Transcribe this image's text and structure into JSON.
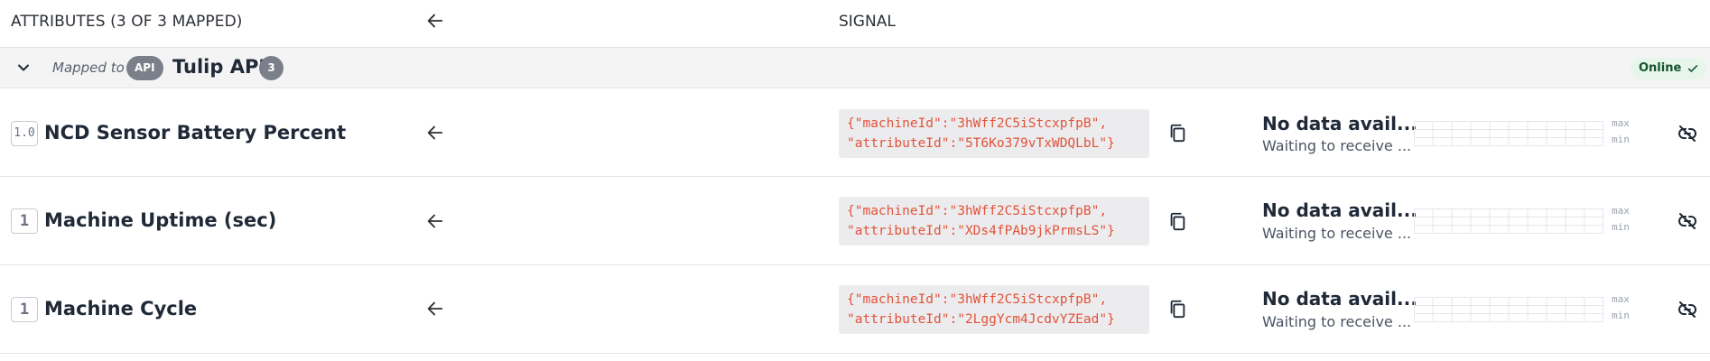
{
  "header": {
    "attributes_title": "ATTRIBUTES (3 OF 3 MAPPED)",
    "signal_title": "SIGNAL"
  },
  "group": {
    "mapped_to_label": "Mapped to",
    "api_badge": "API",
    "api_name": "Tulip API",
    "count": "3",
    "status_label": "Online"
  },
  "rows": [
    {
      "type_badge": "1.0",
      "name": "NCD Sensor Battery Percent",
      "signal_line1": "{\"machineId\":\"3hWff2C5iStcxpfpB\",",
      "signal_line2": "\"attributeId\":\"5T6Ko379vTxWDQLbL\"}",
      "status_title": "No data avail...",
      "status_sub": "Waiting to receive ...",
      "max_label": "max",
      "min_label": "min"
    },
    {
      "type_badge": "1",
      "name": "Machine Uptime (sec)",
      "signal_line1": "{\"machineId\":\"3hWff2C5iStcxpfpB\",",
      "signal_line2": "\"attributeId\":\"XDs4fPAb9jkPrmsLS\"}",
      "status_title": "No data avail...",
      "status_sub": "Waiting to receive ...",
      "max_label": "max",
      "min_label": "min"
    },
    {
      "type_badge": "1",
      "name": "Machine Cycle",
      "signal_line1": "{\"machineId\":\"3hWff2C5iStcxpfpB\",",
      "signal_line2": "\"attributeId\":\"2LggYcm4JcdvYZEad\"}",
      "status_title": "No data avail...",
      "status_sub": "Waiting to receive ...",
      "max_label": "max",
      "min_label": "min"
    }
  ],
  "icons": {
    "arrow": "arrow-left-icon",
    "chevron": "chevron-down-icon",
    "check": "check-icon",
    "copy": "copy-icon",
    "unlink": "unlink-icon"
  },
  "colors": {
    "signal_text": "#e2533a",
    "online_bg": "#e7f6ea",
    "badge_gray": "#7a7f89"
  }
}
